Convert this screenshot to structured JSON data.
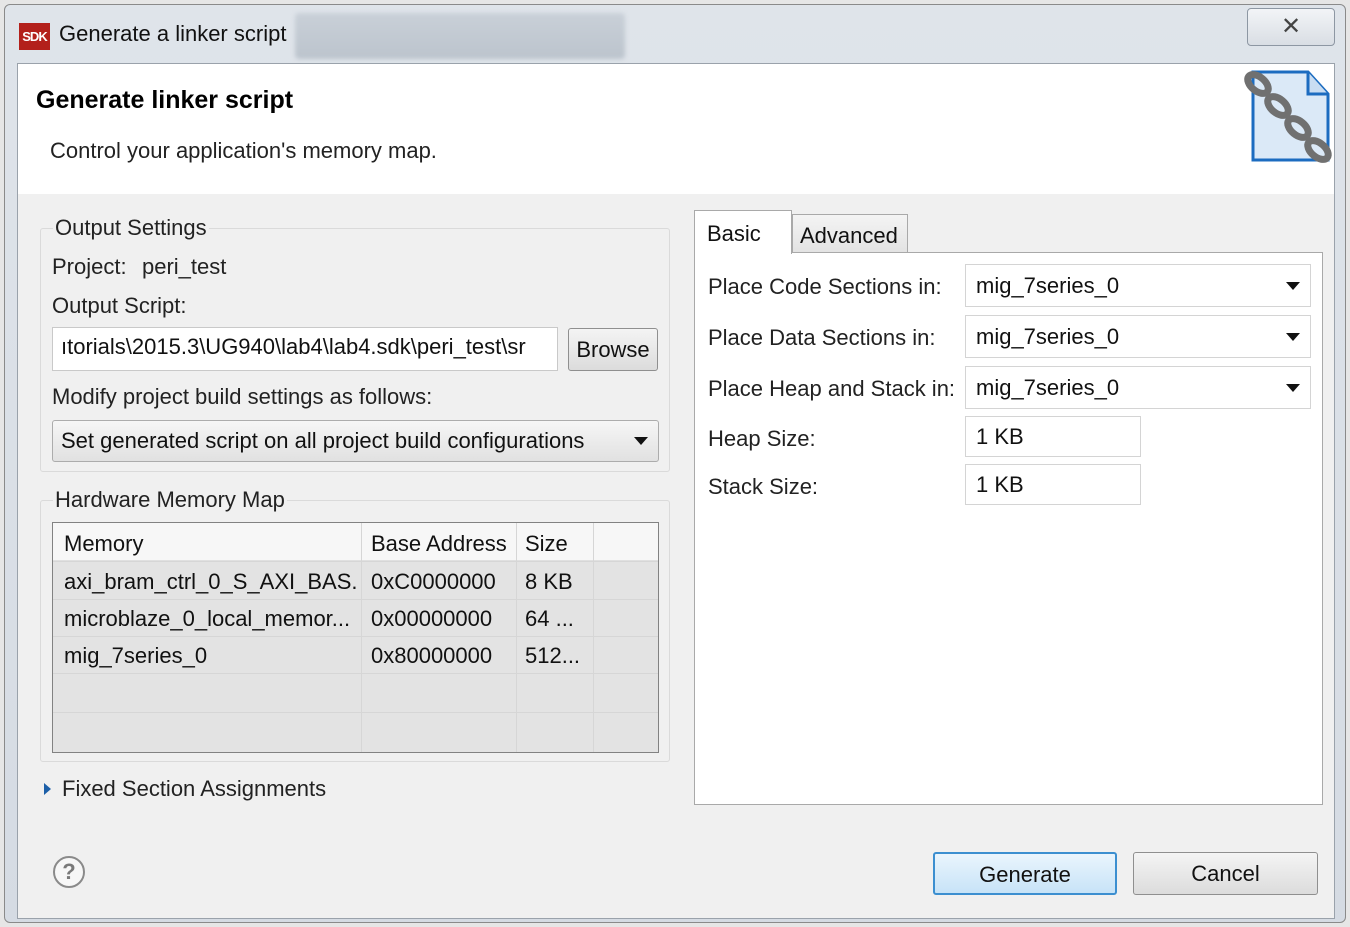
{
  "window": {
    "title": "Generate a linker script",
    "close_glyph": "✕",
    "app_logo_text": "SDK"
  },
  "banner": {
    "title": "Generate linker script",
    "description": "Control your application's memory map.",
    "icon": "linker-document-chain-icon"
  },
  "output_settings": {
    "legend": "Output Settings",
    "project_label": "Project:",
    "project_value": "peri_test",
    "output_script_label": "Output Script:",
    "output_script_value": "ıtorials\\2015.3\\UG940\\lab4\\lab4.sdk\\peri_test\\sr",
    "browse_label": "Browse",
    "modify_label": "Modify project build settings as follows:",
    "modify_selected": "Set generated script on all project build configurations"
  },
  "memory_map": {
    "legend": "Hardware Memory Map",
    "columns": [
      "Memory",
      "Base Address",
      "Size"
    ],
    "rows": [
      {
        "memory": "axi_bram_ctrl_0_S_AXI_BAS...",
        "base": "0xC0000000",
        "size": "8 KB"
      },
      {
        "memory": "microblaze_0_local_memor...",
        "base": "0x00000000",
        "size": "64 ..."
      },
      {
        "memory": "mig_7series_0",
        "base": "0x80000000",
        "size": "512..."
      }
    ]
  },
  "fixed_sections": {
    "label": "Fixed Section Assignments"
  },
  "tabs": {
    "basic": "Basic",
    "advanced": "Advanced"
  },
  "basic": {
    "code_label": "Place Code Sections in:",
    "code_value": "mig_7series_0",
    "data_label": "Place Data Sections in:",
    "data_value": "mig_7series_0",
    "heap_stack_label": "Place Heap and Stack in:",
    "heap_stack_value": "mig_7series_0",
    "heap_size_label": "Heap Size:",
    "heap_size_value": "1 KB",
    "stack_size_label": "Stack Size:",
    "stack_size_value": "1 KB"
  },
  "footer": {
    "help_glyph": "?",
    "generate_label": "Generate",
    "cancel_label": "Cancel"
  }
}
